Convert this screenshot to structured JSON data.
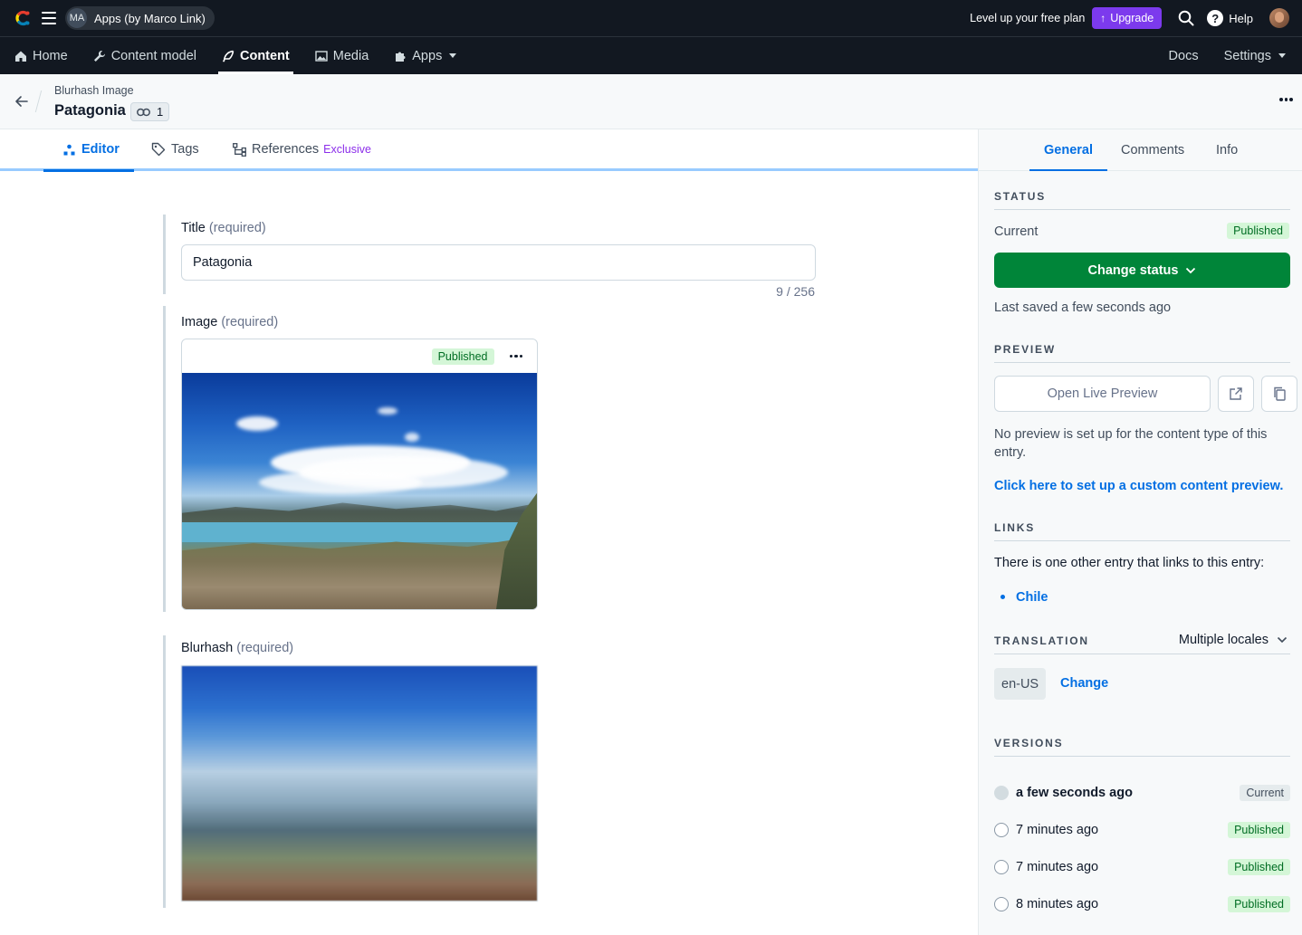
{
  "topbar": {
    "space_initials": "MA",
    "space_name": "Apps (by Marco Link)",
    "levelup_text": "Level up your free plan",
    "upgrade_label": "Upgrade",
    "help_label": "Help"
  },
  "nav": {
    "items": [
      {
        "label": "Home",
        "icon": "home-icon"
      },
      {
        "label": "Content model",
        "icon": "wrench-icon"
      },
      {
        "label": "Content",
        "icon": "feather-icon"
      },
      {
        "label": "Media",
        "icon": "image-icon"
      },
      {
        "label": "Apps",
        "icon": "puzzle-icon"
      }
    ],
    "active": "Content",
    "docs_label": "Docs",
    "settings_label": "Settings"
  },
  "entry": {
    "content_type": "Blurhash Image",
    "title": "Patagonia",
    "links_count": "1"
  },
  "editor_tabs": {
    "editor": "Editor",
    "tags": "Tags",
    "references": "References",
    "references_badge": "Exclusive"
  },
  "fields": {
    "title": {
      "label": "Title",
      "required": "(required)",
      "value": "Patagonia",
      "counter": "9 / 256"
    },
    "image": {
      "label": "Image",
      "required": "(required)",
      "status": "Published"
    },
    "blurhash": {
      "label": "Blurhash",
      "required": "(required)"
    }
  },
  "sidebar": {
    "tabs": {
      "general": "General",
      "comments": "Comments",
      "info": "Info"
    },
    "status": {
      "title": "STATUS",
      "current_label": "Current",
      "current_badge": "Published",
      "change_button": "Change status",
      "last_saved": "Last saved a few seconds ago"
    },
    "preview": {
      "title": "PREVIEW",
      "open_button": "Open Live Preview",
      "note": "No preview is set up for the content type of this entry.",
      "setup_link": "Click here to set up a custom content preview."
    },
    "links": {
      "title": "LINKS",
      "text": "There is one other entry that links to this entry:",
      "items": [
        "Chile"
      ]
    },
    "translation": {
      "title": "TRANSLATION",
      "selector": "Multiple locales",
      "locale": "en-US",
      "change_label": "Change"
    },
    "versions": {
      "title": "VERSIONS",
      "items": [
        {
          "time": "a few seconds ago",
          "badge": "Current"
        },
        {
          "time": "7 minutes ago",
          "badge": "Published"
        },
        {
          "time": "7 minutes ago",
          "badge": "Published"
        },
        {
          "time": "8 minutes ago",
          "badge": "Published"
        }
      ]
    }
  },
  "colors": {
    "primary": "#036fe3",
    "positive": "#008539",
    "upgrade": "#7c3aed",
    "topbar_bg": "#121821"
  }
}
